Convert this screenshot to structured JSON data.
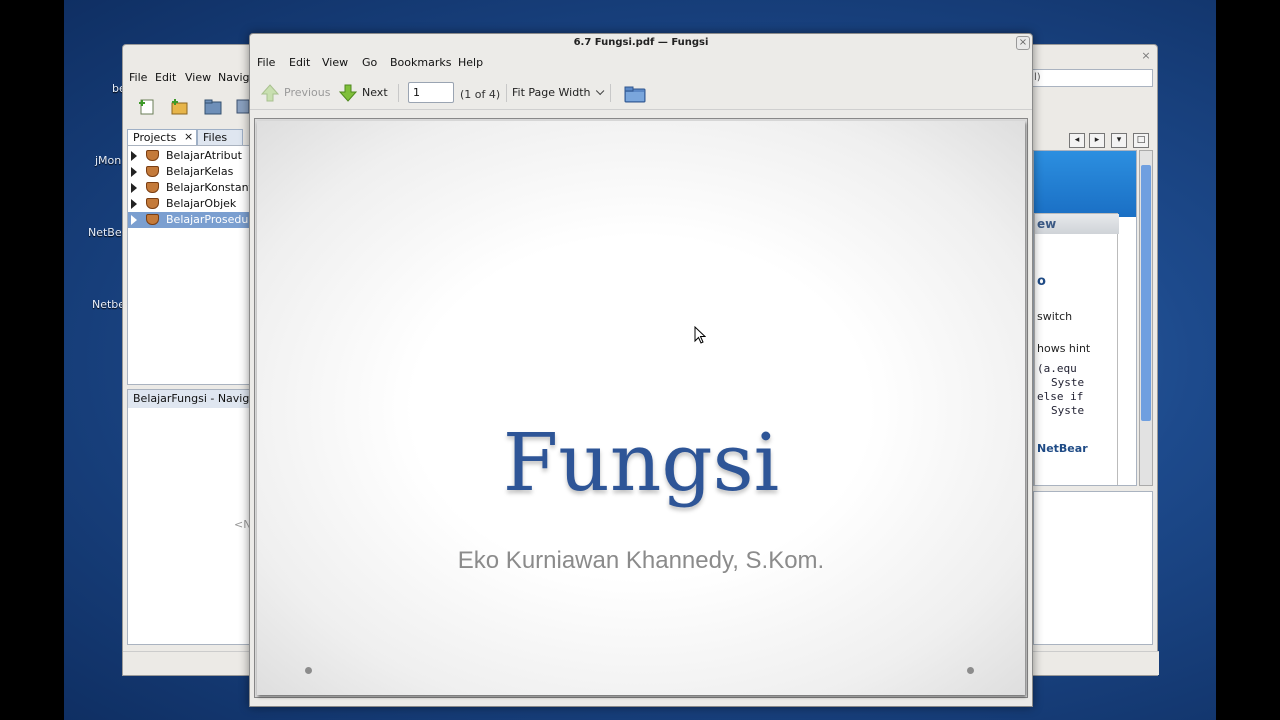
{
  "desktop": {
    "labels": [
      "be",
      "jMon",
      "NetBe",
      "Netbe"
    ]
  },
  "netbeans": {
    "menu": [
      "File",
      "Edit",
      "View",
      "Navig"
    ],
    "tabs": [
      "Projects",
      "Files"
    ],
    "tab_close": "×",
    "projects": [
      "BelajarAtribut",
      "BelajarKelas",
      "BelajarKonstant",
      "BelajarObjek",
      "BelajarProsedur"
    ],
    "selected_project": 4,
    "navigator_title": "BelajarFungsi - Navigato",
    "navigator_empty": "<N",
    "search_text": "l)",
    "right_panel": {
      "header": "ew",
      "lines": [
        "o",
        "switch",
        "hows hint",
        "(a.equ",
        "Syste",
        "else if",
        "Syste",
        "NetBear"
      ]
    },
    "controls": [
      "◂",
      "▸",
      "▾",
      "□"
    ]
  },
  "viewer": {
    "title": "6.7 Fungsi.pdf — Fungsi",
    "close": "×",
    "menu": [
      "File",
      "Edit",
      "View",
      "Go",
      "Bookmarks",
      "Help"
    ],
    "previous_label": "Previous",
    "next_label": "Next",
    "page_value": "1",
    "page_of": "(1 of 4)",
    "zoom": "Fit Page Width",
    "colors": {
      "accent_arrow": "#7fbf3a",
      "title_blue": "#2e5597"
    }
  },
  "slide": {
    "title": "Fungsi",
    "subtitle": "Eko Kurniawan Khannedy, S.Kom."
  }
}
